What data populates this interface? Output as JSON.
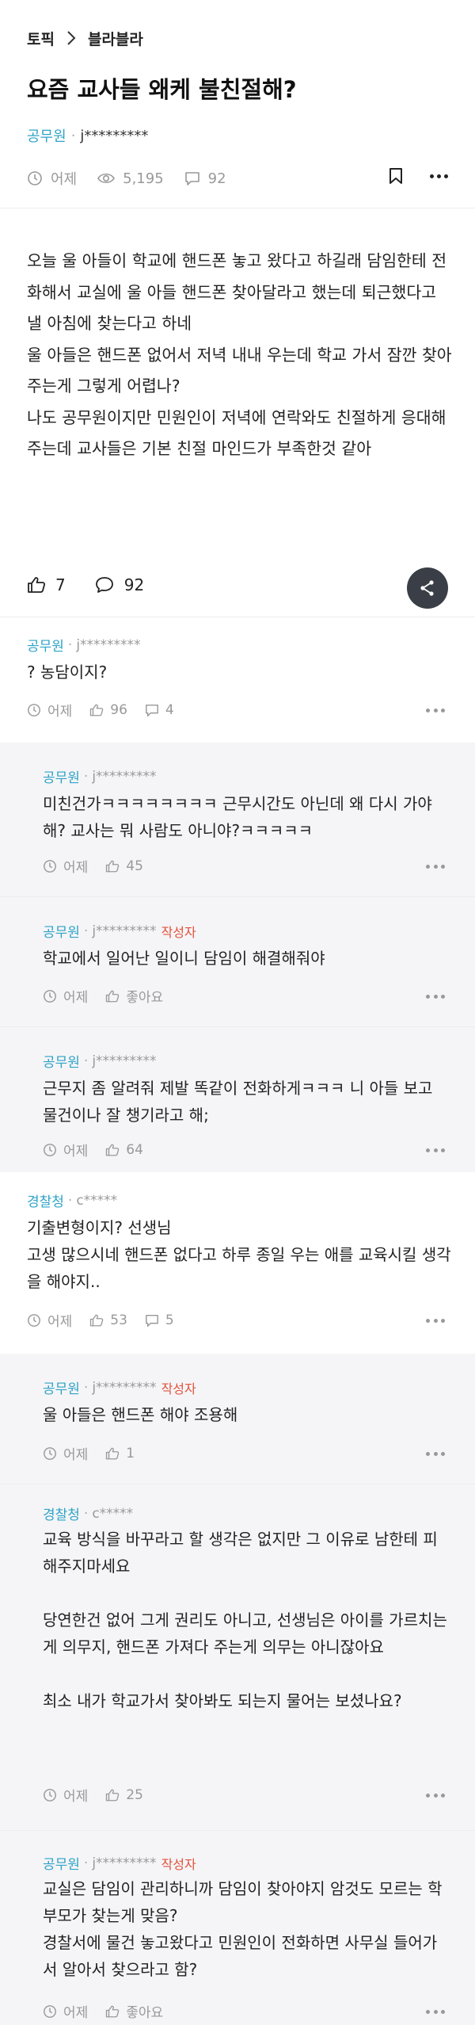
{
  "breadcrumb": {
    "topic": "토픽",
    "board": "블라블라"
  },
  "post": {
    "title": "요즘 교사들 왜케 불친절해?",
    "author_category": "공무원",
    "author_id": "j*********",
    "time": "어제",
    "views": "5,195",
    "comments": "92",
    "body": "오늘 울 아들이 학교에 핸드폰 놓고 왔다고 하길래 담임한테 전화해서 교실에 울 아들 핸드폰 찾아달라고 했는데 퇴근했다고 낼 아침에 찾는다고 하네\n울 아들은 핸드폰 없어서 저녁 내내 우는데 학교 가서 잠깐 찾아주는게 그렇게 어렵나?\n나도 공무원이지만 민원인이 저녁에 연락와도 친절하게 응대해주는데 교사들은 기본 친절 마인드가 부족한것 같아",
    "likes": "7",
    "comment_count": "92"
  },
  "comments": [
    {
      "category": "공무원",
      "user": "j*********",
      "writer_tag": "",
      "text": "? 농담이지?",
      "time": "어제",
      "likes": "96",
      "replies": "4"
    },
    {
      "category": "공무원",
      "user": "j*********",
      "writer_tag": "",
      "text": "미친건가ㅋㅋㅋㅋㅋㅋㅋㅋ 근무시간도 아닌데 왜 다시 가야해? 교사는 뭐 사람도 아니야?ㅋㅋㅋㅋㅋ",
      "time": "어제",
      "likes": "45",
      "replies": ""
    },
    {
      "category": "공무원",
      "user": "j*********",
      "writer_tag": "작성자",
      "text": "학교에서 일어난 일이니 담임이 해결해줘야",
      "time": "어제",
      "likes": "좋아요",
      "replies": ""
    },
    {
      "category": "공무원",
      "user": "j*********",
      "writer_tag": "",
      "text": "근무지 좀 알려줘 제발 똑같이 전화하게ㅋㅋㅋ 니 아들 보고 물건이나 잘 챙기라고 해;",
      "time": "어제",
      "likes": "64",
      "replies": ""
    },
    {
      "category": "경찰청",
      "user": "c*****",
      "writer_tag": "",
      "text": "기출변형이지? 선생님\n고생 많으시네 핸드폰 없다고 하루 종일 우는 애를 교육시킬 생각을 해야지..",
      "time": "어제",
      "likes": "53",
      "replies": "5"
    },
    {
      "category": "공무원",
      "user": "j*********",
      "writer_tag": "작성자",
      "text": "울 아들은 핸드폰 해야 조용해",
      "time": "어제",
      "likes": "1",
      "replies": ""
    },
    {
      "category": "경찰청",
      "user": "c*****",
      "writer_tag": "",
      "text": "교육 방식을 바꾸라고 할 생각은 없지만 그 이유로 남한테 피해주지마세요\n\n당연한건 없어 그게 권리도 아니고, 선생님은 아이를 가르치는게 의무지, 핸드폰 가져다 주는게 의무는 아니잖아요\n\n최소 내가 학교가서 찾아봐도 되는지 물어는 보셨나요?",
      "time": "어제",
      "likes": "25",
      "replies": ""
    },
    {
      "category": "공무원",
      "user": "j*********",
      "writer_tag": "작성자",
      "text": "교실은 담임이 관리하니까 담임이 찾아야지 암것도 모르는 학부모가 찾는게 맞음?\n경찰서에 물건 놓고왔다고 민원인이 전화하면 사무실 들어가서 알아서 찾으라고 함?",
      "time": "어제",
      "likes": "좋아요",
      "replies": ""
    }
  ]
}
